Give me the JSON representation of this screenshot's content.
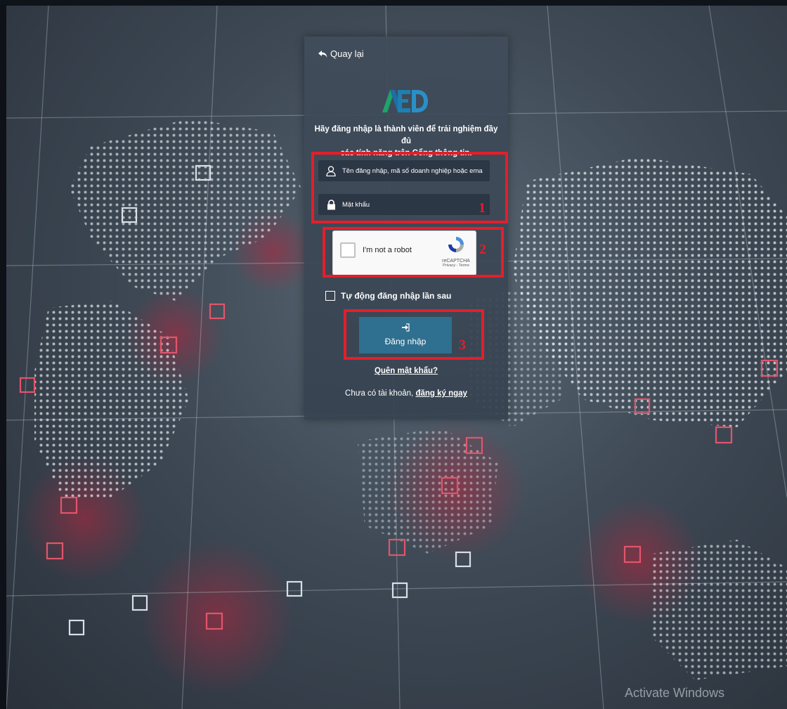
{
  "panel": {
    "back_label": "Quay lại",
    "intro_line1": "Hãy đăng nhập là thành viên để trải nghiệm đầy đủ",
    "intro_line2": "các tính năng trên Cổng thông tin.",
    "username_placeholder": "Tên đăng nhập, mã số doanh nghiệp hoặc email",
    "password_placeholder": "Mật khẩu",
    "captcha": {
      "label": "I'm not a robot",
      "brand": "reCAPTCHA",
      "links": "Privacy - Terms"
    },
    "remember_label": "Tự động đăng nhập lần sau",
    "login_label": "Đăng nhập",
    "forgot_label": "Quên mật khẩu?",
    "signup_prefix": "Chưa có tài khoản, ",
    "signup_link": "đăng ký ngay"
  },
  "annotations": {
    "box1_number": "1",
    "box2_number": "2",
    "box3_number": "3",
    "color": "#e41e2a"
  },
  "watermark": "Activate Windows",
  "icons": [
    "back-arrow-icon",
    "user-icon",
    "lock-icon",
    "login-icon",
    "recaptcha-icon"
  ],
  "colors": {
    "panel": "#3f4b59",
    "field": "#2c3746",
    "button": "#2f6f8f",
    "highlight": "#e41e2a"
  }
}
